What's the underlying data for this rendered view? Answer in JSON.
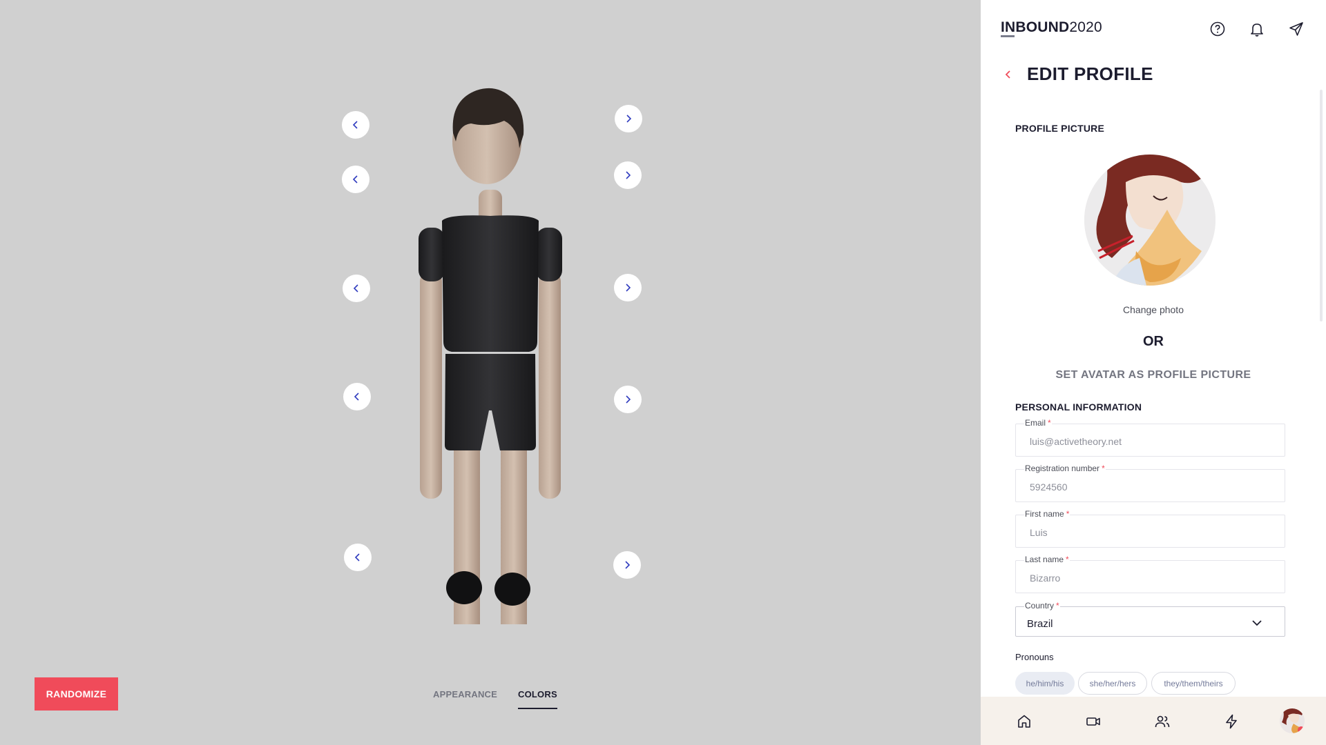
{
  "stage": {
    "arrows": {
      "left_icon": "chevron-left-icon",
      "right_icon": "chevron-right-icon",
      "color": "#2f3bbf"
    },
    "randomize_label": "RANDOMIZE",
    "tabs": [
      {
        "label": "APPEARANCE",
        "active": false
      },
      {
        "label": "COLORS",
        "active": true
      }
    ]
  },
  "header": {
    "brand_bold": "INBOUND",
    "brand_light": "2020",
    "icons": [
      "help-circle-icon",
      "bell-icon",
      "send-icon"
    ]
  },
  "page": {
    "title": "EDIT PROFILE",
    "back_icon": "chevron-left-icon",
    "accent_color": "#f04b5a"
  },
  "profile_picture": {
    "section_label": "PROFILE PICTURE",
    "change_photo": "Change photo",
    "or": "OR",
    "set_avatar": "SET AVATAR AS PROFILE PICTURE"
  },
  "personal": {
    "section_label": "PERSONAL INFORMATION",
    "fields": [
      {
        "label": "Email",
        "required": "*",
        "value": "luis@activetheory.net"
      },
      {
        "label": "Registration number",
        "required": "*",
        "value": "5924560"
      },
      {
        "label": "First name",
        "required": "*",
        "value": "Luis"
      },
      {
        "label": "Last name",
        "required": "*",
        "value": "Bizarro"
      }
    ],
    "country": {
      "label": "Country",
      "required": "*",
      "value": "Brazil"
    },
    "pronouns_label": "Pronouns",
    "pronouns": [
      {
        "label": "he/him/his",
        "selected": true
      },
      {
        "label": "she/her/hers",
        "selected": false
      },
      {
        "label": "they/them/theirs",
        "selected": false
      }
    ]
  },
  "bottom_nav": {
    "items": [
      "home-icon",
      "video-camera-icon",
      "people-icon",
      "lightning-icon",
      "profile-avatar"
    ]
  }
}
